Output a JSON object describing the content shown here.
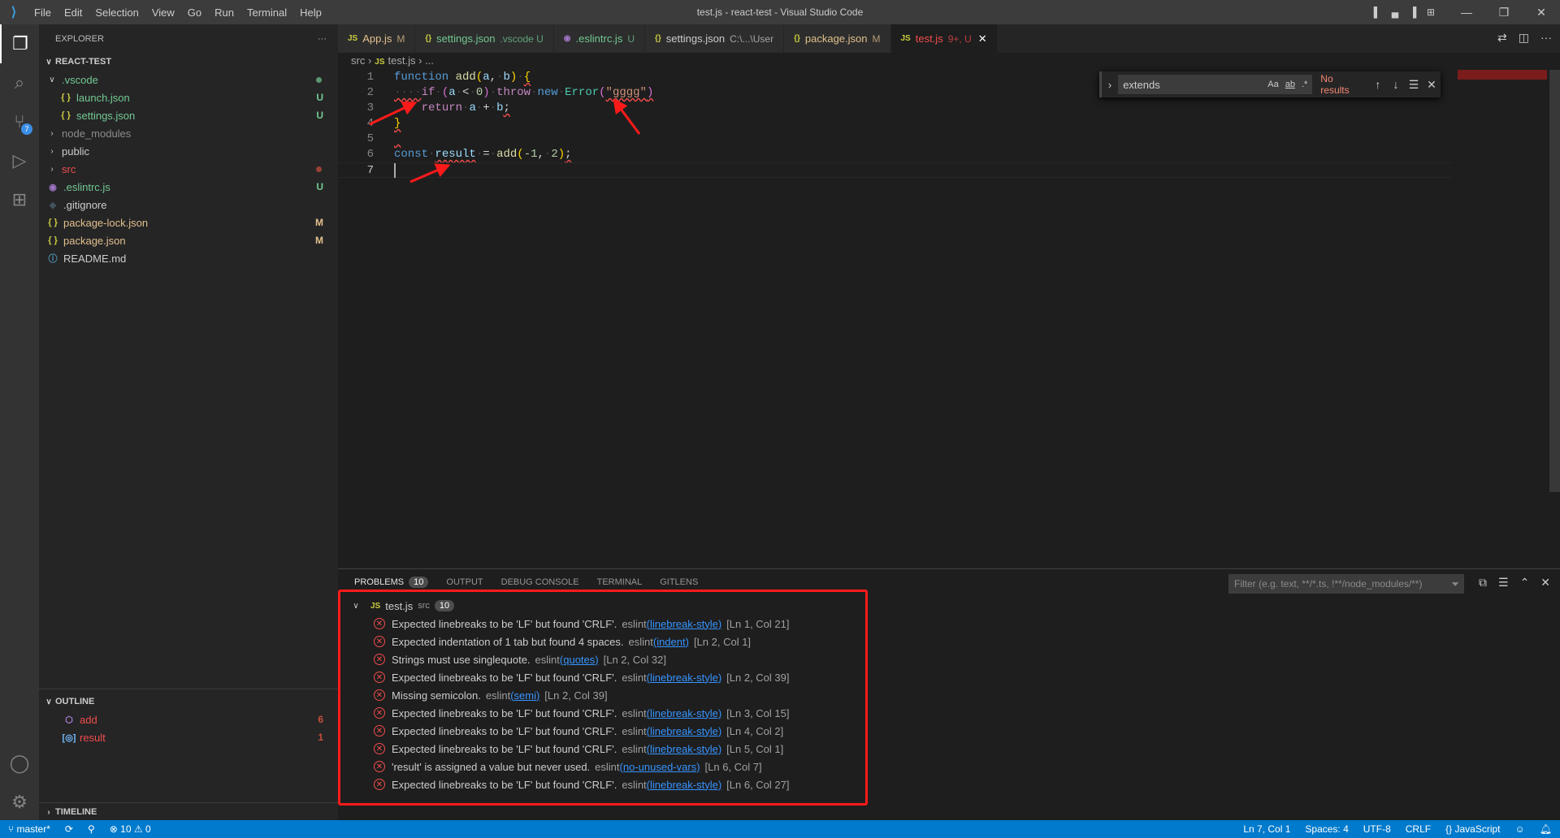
{
  "window": {
    "title": "test.js - react-test - Visual Studio Code",
    "menu": [
      "File",
      "Edit",
      "Selection",
      "View",
      "Go",
      "Run",
      "Terminal",
      "Help"
    ]
  },
  "activity": {
    "scm_badge": "7"
  },
  "sidebar": {
    "explorer_label": "EXPLORER",
    "more": "···",
    "root": "REACT-TEST",
    "items": [
      {
        "label": ".vscode",
        "level": 1,
        "kind": "folder-open",
        "color": "#73c991",
        "deco": "dot",
        "decoColor": "#73c991"
      },
      {
        "label": "launch.json",
        "level": 2,
        "kind": "json",
        "color": "#73c991",
        "deco": "U",
        "decoColor": "#73c991"
      },
      {
        "label": "settings.json",
        "level": 2,
        "kind": "json",
        "color": "#73c991",
        "deco": "U",
        "decoColor": "#73c991"
      },
      {
        "label": "node_modules",
        "level": 1,
        "kind": "folder",
        "color": "#8c8c8c",
        "deco": "",
        "decoColor": ""
      },
      {
        "label": "public",
        "level": 1,
        "kind": "folder",
        "color": "#cccccc",
        "deco": "",
        "decoColor": ""
      },
      {
        "label": "src",
        "level": 1,
        "kind": "folder",
        "color": "#f14c4c",
        "deco": "dot",
        "decoColor": "#c74e39"
      },
      {
        "label": ".eslintrc.js",
        "level": 1,
        "kind": "eslint",
        "color": "#73c991",
        "deco": "U",
        "decoColor": "#73c991"
      },
      {
        "label": ".gitignore",
        "level": 1,
        "kind": "git",
        "color": "#cccccc",
        "deco": "",
        "decoColor": ""
      },
      {
        "label": "package-lock.json",
        "level": 1,
        "kind": "json",
        "color": "#e2c08d",
        "deco": "M",
        "decoColor": "#e2c08d"
      },
      {
        "label": "package.json",
        "level": 1,
        "kind": "json",
        "color": "#e2c08d",
        "deco": "M",
        "decoColor": "#e2c08d"
      },
      {
        "label": "README.md",
        "level": 1,
        "kind": "info",
        "color": "#cccccc",
        "deco": "",
        "decoColor": ""
      }
    ],
    "outline_label": "OUTLINE",
    "outline": [
      {
        "label": "add",
        "kind": "function",
        "count": "6"
      },
      {
        "label": "result",
        "kind": "variable",
        "count": "1"
      }
    ],
    "timeline_label": "TIMELINE"
  },
  "tabs": [
    {
      "icon": "JS",
      "label": "App.js",
      "desc": "M",
      "color": "#e2c08d",
      "active": false
    },
    {
      "icon": "{}",
      "label": "settings.json",
      "desc": ".vscode U",
      "color": "#73c991",
      "active": false
    },
    {
      "icon": "◉",
      "label": ".eslintrc.js",
      "desc": "U",
      "color": "#73c991",
      "active": false
    },
    {
      "icon": "{}",
      "label": "settings.json",
      "desc": "C:\\...\\User",
      "color": "#cccccc",
      "active": false
    },
    {
      "icon": "{}",
      "label": "package.json",
      "desc": "M",
      "color": "#e2c08d",
      "active": false
    },
    {
      "icon": "JS",
      "label": "test.js",
      "desc": "9+, U",
      "color": "#f14c4c",
      "active": true
    }
  ],
  "breadcrumb": {
    "folder": "src",
    "file": "test.js",
    "rest": "..."
  },
  "editor": {
    "lines": [
      [
        [
          "function",
          "kw"
        ],
        [
          " ",
          "ws"
        ],
        [
          "add",
          "fn"
        ],
        [
          "(",
          "b1"
        ],
        [
          "a",
          "pa"
        ],
        [
          ",",
          "p"
        ],
        [
          "·",
          "ws"
        ],
        [
          "b",
          "pa"
        ],
        [
          ")",
          "b1"
        ],
        [
          "·",
          "ws"
        ],
        [
          "{",
          "b1 sq"
        ]
      ],
      [
        [
          "····",
          "ws sq"
        ],
        [
          "if",
          "ctrl"
        ],
        [
          "·",
          "ws"
        ],
        [
          "(",
          "b2"
        ],
        [
          "a",
          "pa"
        ],
        [
          "·",
          "ws"
        ],
        [
          "<",
          "p"
        ],
        [
          "·",
          "ws"
        ],
        [
          "0",
          "num"
        ],
        [
          ")",
          "b2"
        ],
        [
          "·",
          "ws"
        ],
        [
          "throw",
          "ctrl"
        ],
        [
          "·",
          "ws"
        ],
        [
          "new",
          "kw"
        ],
        [
          "·",
          "ws"
        ],
        [
          "Error",
          "cls"
        ],
        [
          "(",
          "b2"
        ],
        [
          "\"gggg\"",
          "str sq"
        ],
        [
          ")",
          "b2 sq"
        ]
      ],
      [
        [
          "    ",
          "p"
        ],
        [
          "return",
          "ctrl"
        ],
        [
          "·",
          "ws"
        ],
        [
          "a",
          "pa"
        ],
        [
          "·",
          "ws"
        ],
        [
          "+",
          "p"
        ],
        [
          "·",
          "ws"
        ],
        [
          "b",
          "pa"
        ],
        [
          ";",
          "p sq"
        ]
      ],
      [
        [
          "}",
          "b1 sq"
        ]
      ],
      [
        [
          " ",
          "p sq"
        ]
      ],
      [
        [
          "const",
          "kw"
        ],
        [
          "·",
          "ws"
        ],
        [
          "result",
          "pa sq"
        ],
        [
          "·",
          "ws"
        ],
        [
          "=",
          "p"
        ],
        [
          "·",
          "ws"
        ],
        [
          "add",
          "fn"
        ],
        [
          "(",
          "b1"
        ],
        [
          "-1",
          "num"
        ],
        [
          ",",
          "p"
        ],
        [
          "·",
          "ws"
        ],
        [
          "2",
          "num"
        ],
        [
          ")",
          "b1"
        ],
        [
          ";",
          "p sq"
        ]
      ],
      []
    ]
  },
  "find": {
    "value": "extends",
    "match_case": "Aa",
    "whole_word": "ab",
    "regex": ".*",
    "status": "No results"
  },
  "panel": {
    "tabs": [
      {
        "label": "PROBLEMS",
        "count": "10",
        "active": true
      },
      {
        "label": "OUTPUT"
      },
      {
        "label": "DEBUG CONSOLE"
      },
      {
        "label": "TERMINAL"
      },
      {
        "label": "GITLENS"
      }
    ],
    "filter_placeholder": "Filter (e.g. text, **/*.ts, !**/node_modules/**)",
    "file": {
      "name": "test.js",
      "dir": "src",
      "count": "10"
    },
    "problems": [
      {
        "msg": "Expected linebreaks to be 'LF' but found 'CRLF'.",
        "src": "eslint",
        "code": "(linebreak-style)",
        "loc": "[Ln 1, Col 21]"
      },
      {
        "msg": "Expected indentation of 1 tab but found 4 spaces.",
        "src": "eslint",
        "code": "(indent)",
        "loc": "[Ln 2, Col 1]"
      },
      {
        "msg": "Strings must use singlequote.",
        "src": "eslint",
        "code": "(quotes)",
        "loc": "[Ln 2, Col 32]"
      },
      {
        "msg": "Expected linebreaks to be 'LF' but found 'CRLF'.",
        "src": "eslint",
        "code": "(linebreak-style)",
        "loc": "[Ln 2, Col 39]"
      },
      {
        "msg": "Missing semicolon.",
        "src": "eslint",
        "code": "(semi)",
        "loc": "[Ln 2, Col 39]"
      },
      {
        "msg": "Expected linebreaks to be 'LF' but found 'CRLF'.",
        "src": "eslint",
        "code": "(linebreak-style)",
        "loc": "[Ln 3, Col 15]"
      },
      {
        "msg": "Expected linebreaks to be 'LF' but found 'CRLF'.",
        "src": "eslint",
        "code": "(linebreak-style)",
        "loc": "[Ln 4, Col 2]"
      },
      {
        "msg": "Expected linebreaks to be 'LF' but found 'CRLF'.",
        "src": "eslint",
        "code": "(linebreak-style)",
        "loc": "[Ln 5, Col 1]"
      },
      {
        "msg": "'result' is assigned a value but never used.",
        "src": "eslint",
        "code": "(no-unused-vars)",
        "loc": "[Ln 6, Col 7]"
      },
      {
        "msg": "Expected linebreaks to be 'LF' but found 'CRLF'.",
        "src": "eslint",
        "code": "(linebreak-style)",
        "loc": "[Ln 6, Col 27]"
      }
    ]
  },
  "status": {
    "branch": "master*",
    "errors": "10",
    "warnings": "0",
    "position": "Ln 7, Col 1",
    "spaces": "Spaces: 4",
    "encoding": "UTF-8",
    "eol": "CRLF",
    "language": "JavaScript"
  },
  "colors": {
    "accent": "#007acc",
    "annotation": "#ff1a1a",
    "error": "#f14c4c"
  }
}
